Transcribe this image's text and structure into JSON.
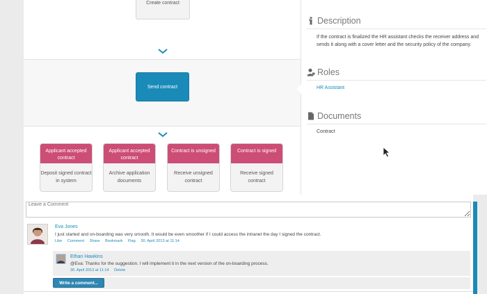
{
  "process": {
    "create_label": "Create contract",
    "send_label": "Send contract",
    "cards": [
      {
        "head": "Applicant accepted contract",
        "body": "Deposit signed contract in system"
      },
      {
        "head": "Applicant accepted contract",
        "body": "Archive application documents"
      },
      {
        "head": "Contract is unsigned",
        "body": "Receive unsigned contract"
      },
      {
        "head": "Contract is signed",
        "body": "Receive signed contract"
      }
    ]
  },
  "panel": {
    "description_title": "Description",
    "description_text": "If the contract is finalized the HR assistant checks the receiver address and sends it along with a cover letter and the security policy of the company.",
    "roles_title": "Roles",
    "role": "HR Assistant",
    "documents_title": "Documents",
    "document": "Contract"
  },
  "comments": {
    "input_placeholder": "Leave a Comment",
    "main": {
      "author": "Eva Jones",
      "text": "I just started and on-boarding was very smooth. It would be even smoother if I could access the intranet the day I signed the contract.",
      "actions": [
        "Like",
        "Comment",
        "Share",
        "Bookmark",
        "Flag",
        "30. April 2013 at 11:14"
      ]
    },
    "reply": {
      "author": "Ethan Hawkins",
      "text": "@Eva: Thanks for the suggestion. I will implement it in the next version of the on-boarding process.",
      "time": "30. April 2013 at 11:14",
      "delete": "Delete"
    },
    "write_button": "Write a comment..."
  },
  "colors": {
    "accent_blue": "#1a8bb8",
    "card_head_pink": "#cc4d75"
  },
  "icons": [
    "info-icon",
    "user-icon",
    "document-icon",
    "chevron-down-icon",
    "cursor-icon"
  ]
}
